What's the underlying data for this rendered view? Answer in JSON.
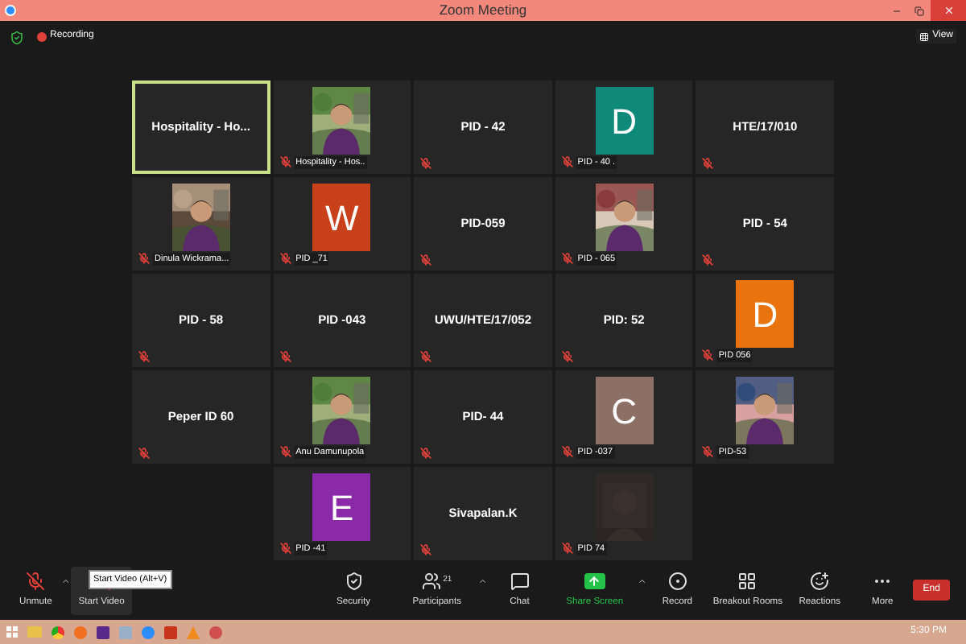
{
  "window": {
    "title": "Zoom Meeting"
  },
  "top_bar": {
    "recording_label": "Recording",
    "view_label": "View"
  },
  "tiles": [
    {
      "kind": "name",
      "name": "Hospitality  -  Ho...",
      "muted": false,
      "active": true
    },
    {
      "label": "Hospitality - Hos..",
      "muted": true,
      "active": false
    },
    {
      "kind": "name",
      "name": "PID - 42",
      "muted": true,
      "active": false
    },
    {
      "kind": "letter",
      "letter": "D",
      "color": "#0f8a7a",
      "label": "PID - 40 .",
      "muted": true,
      "active": false
    },
    {
      "kind": "name",
      "name": "HTE/17/010",
      "muted": true,
      "active": false
    },
    {
      "label": "Dinula Wickrama...",
      "muted": true,
      "active": false
    },
    {
      "kind": "letter",
      "letter": "W",
      "color": "#c8411b",
      "label": "PID _71",
      "muted": true,
      "active": false
    },
    {
      "kind": "name",
      "name": "PID-059",
      "muted": true,
      "active": false
    },
    {
      "label": "PID - 065",
      "muted": true,
      "active": false
    },
    {
      "kind": "name",
      "name": "PID - 54",
      "muted": true,
      "active": false
    },
    {
      "kind": "name",
      "name": "PID - 58",
      "muted": true,
      "active": false
    },
    {
      "kind": "name",
      "name": "PID -043",
      "muted": true,
      "active": false
    },
    {
      "kind": "name",
      "name": "UWU/HTE/17/052",
      "muted": true,
      "active": false
    },
    {
      "kind": "name",
      "name": "PID: 52",
      "muted": true,
      "active": false
    },
    {
      "kind": "letter",
      "letter": "D",
      "color": "#e8730f",
      "label": "PID 056",
      "muted": true,
      "active": false
    },
    {
      "kind": "name",
      "name": "Peper ID 60",
      "muted": true,
      "active": false
    },
    {
      "label": "Anu Damunupola",
      "muted": true,
      "active": false
    },
    {
      "kind": "name",
      "name": "PID- 44",
      "muted": true,
      "active": false
    },
    {
      "kind": "letter",
      "letter": "C",
      "color": "#8c7066",
      "label": "PID -037",
      "muted": true,
      "active": false
    },
    {
      "label": "PID-53",
      "muted": true,
      "active": false
    },
    {
      "kind": "empty"
    },
    {
      "kind": "letter",
      "letter": "E",
      "color": "#8a2aa8",
      "label": "PID -41",
      "muted": true,
      "active": false
    },
    {
      "kind": "name",
      "name": "Sivapalan.K",
      "muted": true,
      "active": false
    },
    {
      "kind": "dark",
      "label": "PID 74",
      "muted": true,
      "active": false
    },
    {
      "kind": "empty"
    }
  ],
  "toolbar": {
    "buttons": [
      {
        "kind": "mic",
        "label": "Unmute",
        "caret": true,
        "hovered": false
      },
      {
        "kind": "video",
        "label": "Start Video",
        "caret": false,
        "hovered": true
      },
      {
        "kind": "security",
        "label": "Security",
        "caret": false,
        "hovered": false
      },
      {
        "kind": "participants",
        "label": "Participants",
        "caret": true,
        "hovered": false
      },
      {
        "kind": "chat",
        "label": "Chat",
        "caret": false,
        "hovered": false
      },
      {
        "kind": "share",
        "label": "Share Screen",
        "caret": true,
        "hovered": false
      },
      {
        "kind": "record",
        "label": "Record",
        "caret": false,
        "hovered": false
      },
      {
        "kind": "breakout",
        "label": "Breakout Rooms",
        "caret": false,
        "hovered": false
      },
      {
        "kind": "reactions",
        "label": "Reactions",
        "caret": false,
        "hovered": false
      },
      {
        "kind": "more",
        "label": "More",
        "caret": false,
        "hovered": false
      }
    ],
    "participants_count": "21",
    "tooltip": "Start Video (Alt+V)",
    "end_label": "End"
  },
  "taskbar": {
    "time": "5:30 PM"
  }
}
